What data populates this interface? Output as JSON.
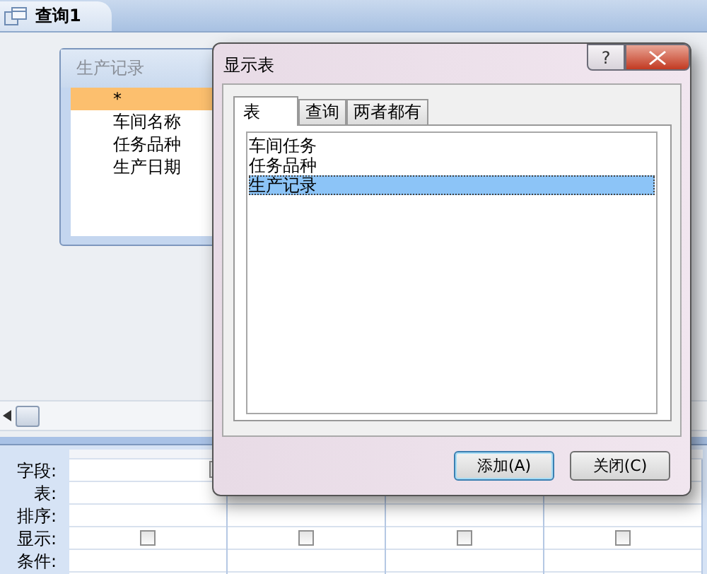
{
  "document_tabs": [
    {
      "label": "查询1",
      "selected": true
    }
  ],
  "table_box": {
    "title": "生产记录",
    "fields": [
      {
        "label": "*",
        "selected": true
      },
      {
        "label": "车间名称",
        "selected": false
      },
      {
        "label": "任务品种",
        "selected": false
      },
      {
        "label": "生产日期",
        "selected": false
      }
    ]
  },
  "grid": {
    "row_labels": [
      "字段:",
      "表:",
      "排序:",
      "显示:",
      "条件:"
    ],
    "columns": [
      {
        "show": false
      },
      {
        "show": false
      },
      {
        "show": false
      },
      {
        "show": false
      }
    ]
  },
  "dialog": {
    "title": "显示表",
    "help": "?",
    "tabs": [
      {
        "label": "表",
        "selected": true
      },
      {
        "label": "查询",
        "selected": false
      },
      {
        "label": "两者都有",
        "selected": false
      }
    ],
    "items": [
      {
        "label": "车间任务",
        "selected": false
      },
      {
        "label": "任务品种",
        "selected": false
      },
      {
        "label": "生产记录",
        "selected": true
      }
    ],
    "buttons": [
      "添加(A)",
      "关闭(C)"
    ]
  }
}
